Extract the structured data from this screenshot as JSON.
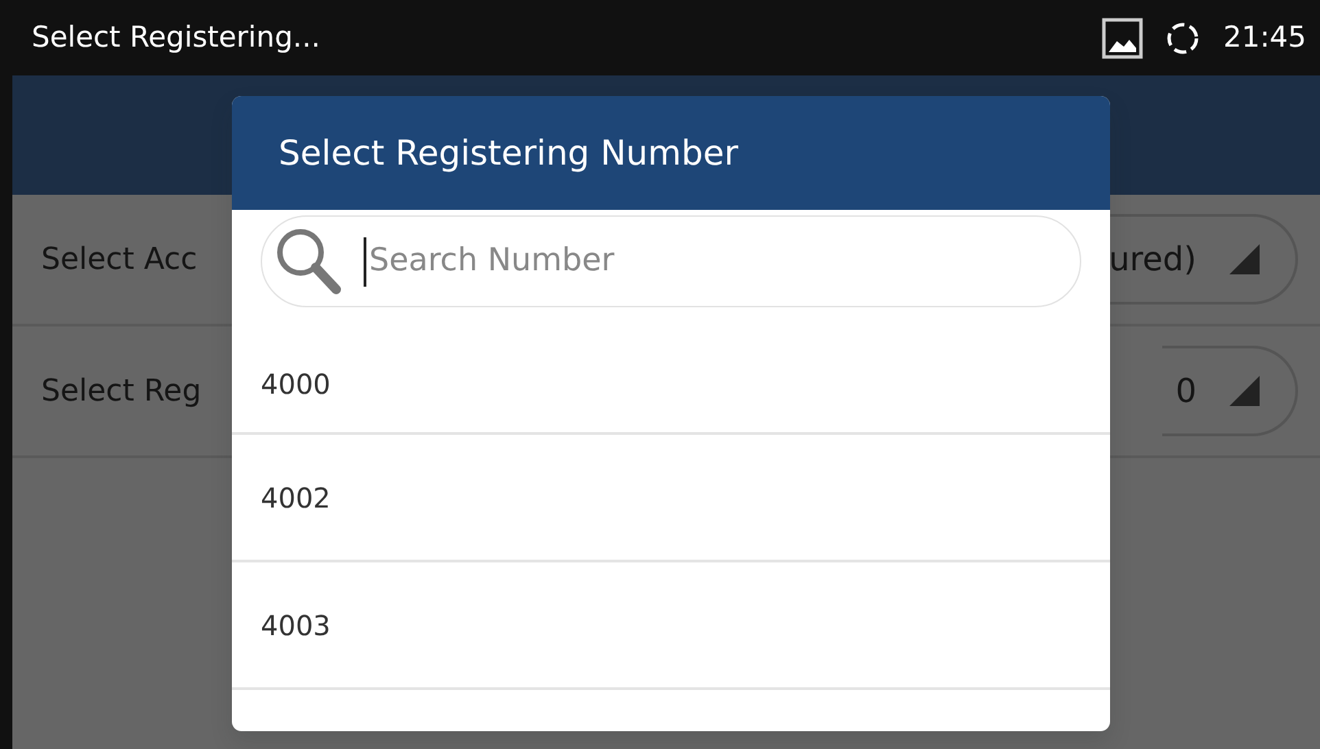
{
  "status_bar": {
    "title": "Select Registering...",
    "time": "21:45"
  },
  "settings": [
    {
      "label": "Select Acc",
      "value": "ured)"
    },
    {
      "label": "Select Reg",
      "value": "0"
    }
  ],
  "dialog": {
    "title": "Select Registering Number",
    "search": {
      "placeholder": "Search Number",
      "focused": true
    },
    "items": [
      {
        "label": "4000"
      },
      {
        "label": "4002"
      },
      {
        "label": "4003"
      }
    ]
  }
}
